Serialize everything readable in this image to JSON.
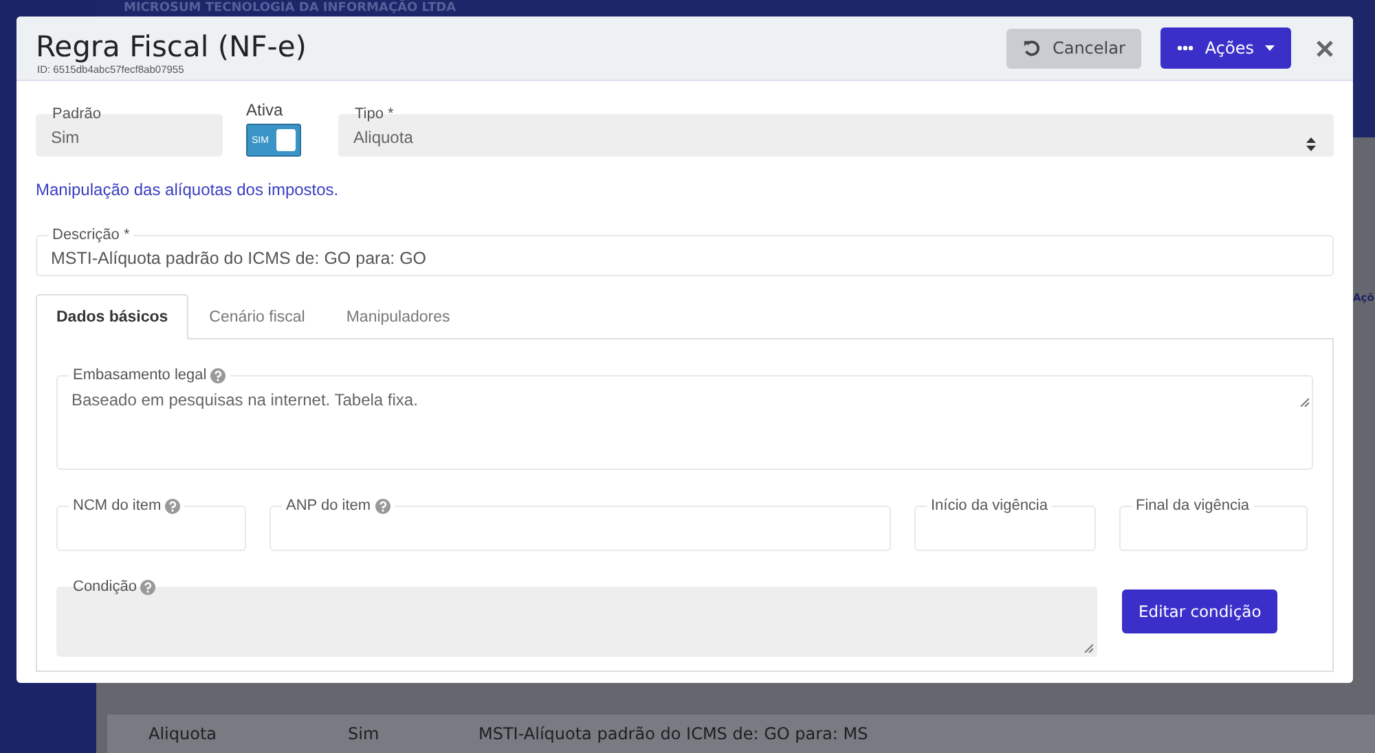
{
  "background": {
    "company": "MICROSUM TECNOLOGIA DA INFORMAÇÃO LTDA",
    "column_header": "Açõ",
    "row": [
      "Aliquota",
      "Sim",
      "MSTI-Alíquota padrão do ICMS de: GO para: MS"
    ]
  },
  "modal": {
    "title": "Regra Fiscal (NF-e)",
    "id": "ID: 6515db4abc57fecf8ab07955",
    "buttons": [
      {
        "label": "Cancelar",
        "kind": "cancel"
      },
      {
        "label": "Ações",
        "kind": "dropdown"
      }
    ],
    "padrao": {
      "label": "Padrão",
      "value": "Sim",
      "disabled": true
    },
    "ativa": {
      "label": "Ativa",
      "on": true,
      "text": "SIM"
    },
    "tipo": {
      "label": "Tipo *",
      "value": "Aliquota",
      "disabled": true
    },
    "help_text": "Manipulação das alíquotas dos impostos.",
    "descricao": {
      "label": "Descrição *",
      "value": "MSTI-Alíquota padrão do ICMS de: GO para: GO"
    },
    "tabs": [
      {
        "label": "Dados básicos",
        "selected": true
      },
      {
        "label": "Cenário fiscal",
        "selected": false
      },
      {
        "label": "Manipuladores",
        "selected": false
      }
    ],
    "embasamento": {
      "label": "Embasamento legal",
      "help": true,
      "value": "Baseado em pesquisas na internet. Tabela fixa."
    },
    "fields": [
      {
        "label": "NCM do item",
        "help": true,
        "kind": "narrow"
      },
      {
        "label": "ANP do item",
        "help": true,
        "kind": "wide"
      },
      {
        "label": "Início da vigência",
        "help": false,
        "kind": "date"
      },
      {
        "label": "Final da vigência",
        "help": false,
        "kind": "date"
      }
    ],
    "condicao": {
      "label": "Condição",
      "help": true,
      "disabled": true
    },
    "edit_button": "Editar condição"
  }
}
